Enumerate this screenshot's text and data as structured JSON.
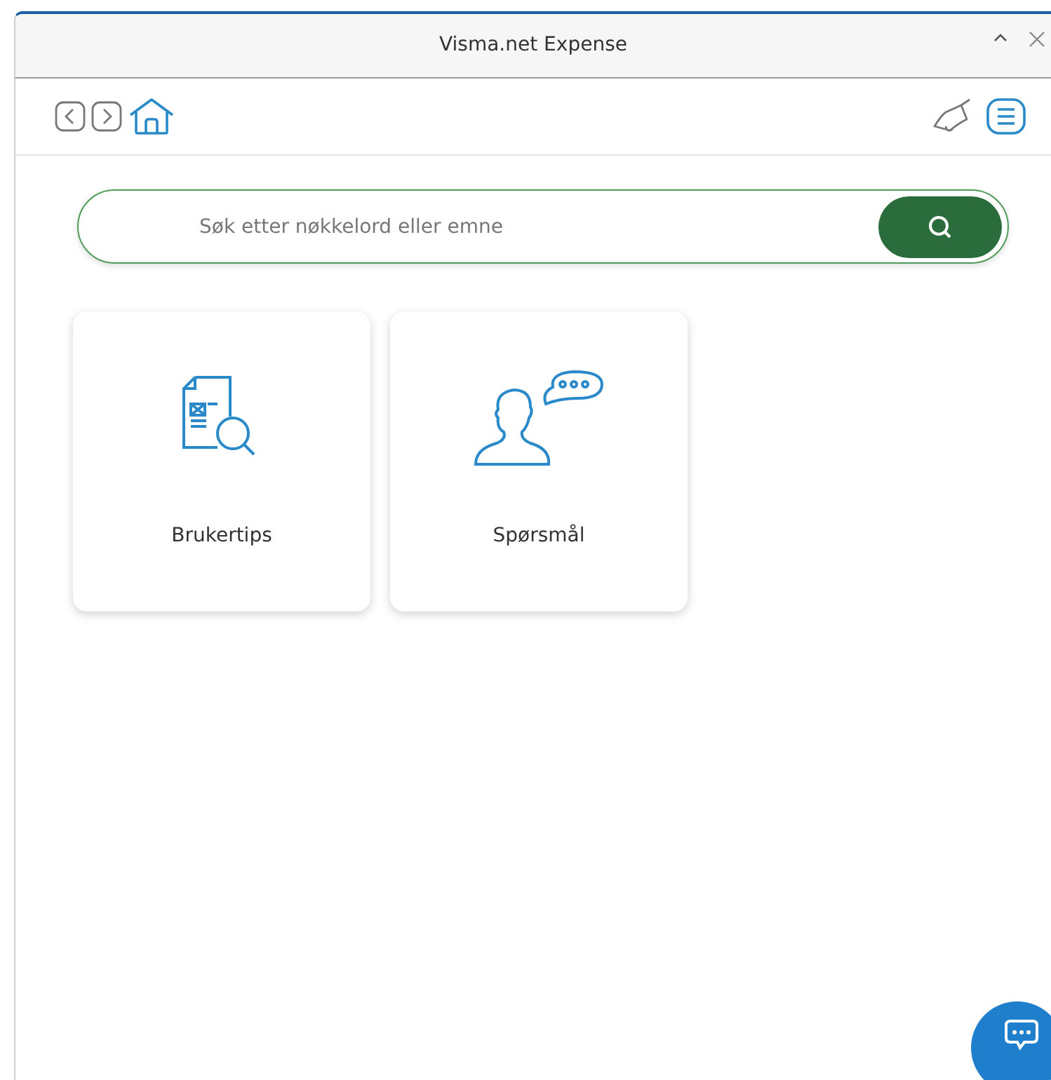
{
  "window": {
    "title": "Visma.net Expense"
  },
  "search": {
    "placeholder": "Søk etter nøkkelord eller emne"
  },
  "tiles": [
    {
      "label": "Brukertips",
      "kind": "document-search"
    },
    {
      "label": "Spørsmål",
      "kind": "person-chat"
    }
  ]
}
